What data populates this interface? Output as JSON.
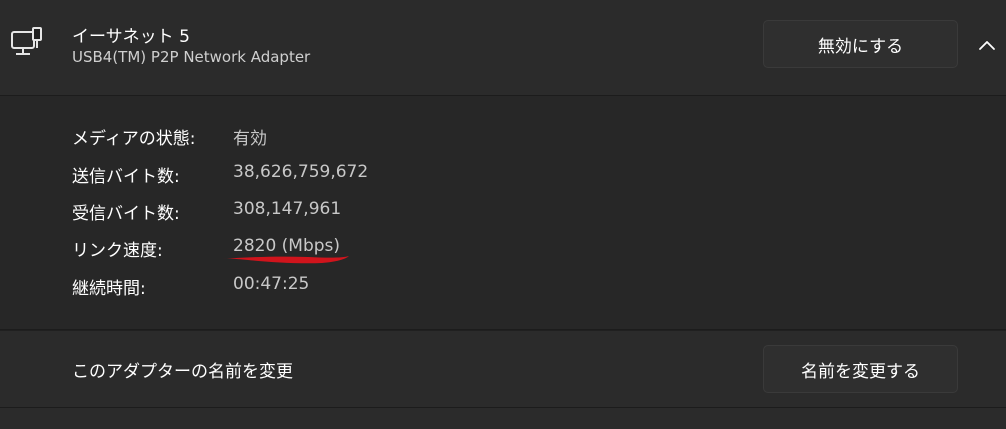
{
  "adapter": {
    "title": "イーサネット 5",
    "subtitle": "USB4(TM) P2P Network Adapter",
    "icon": "network-adapter-icon",
    "disable_label": "無効にする",
    "expand_icon": "chevron-up-icon"
  },
  "properties": [
    {
      "label": "メディアの状態:",
      "value": "有効"
    },
    {
      "label": "送信バイト数:",
      "value": "38,626,759,672"
    },
    {
      "label": "受信バイト数:",
      "value": "308,147,961"
    },
    {
      "label": "リンク速度:",
      "value": "2820 (Mbps)"
    },
    {
      "label": "継続時間:",
      "value": "00:47:25"
    }
  ],
  "rename": {
    "description": "このアダプターの名前を変更",
    "button_label": "名前を変更する"
  },
  "colors": {
    "background": "#202020",
    "card": "#2b2b2b",
    "button": "#2f2f2f",
    "annotation": "#d0141c"
  }
}
